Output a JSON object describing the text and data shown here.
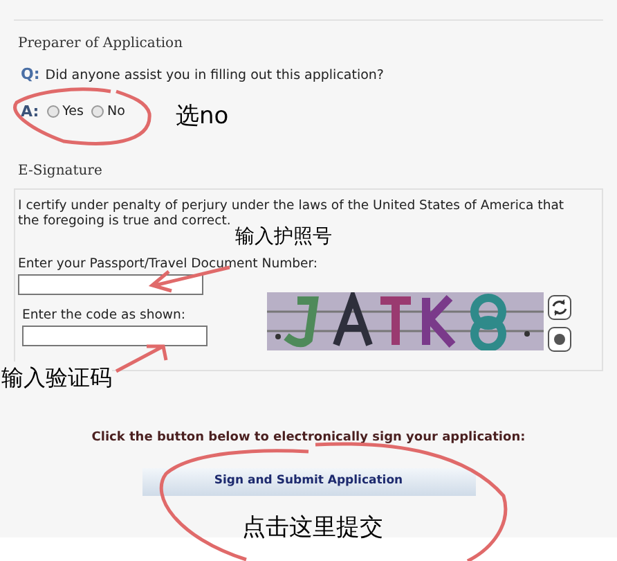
{
  "preparer": {
    "heading": "Preparer of Application",
    "question_marker": "Q:",
    "question": "Did anyone assist you in filling out this application?",
    "answer_marker": "A:",
    "options": [
      {
        "label": "Yes",
        "selected": false
      },
      {
        "label": "No",
        "selected": false
      }
    ]
  },
  "e_signature": {
    "heading": "E-Signature",
    "statement": "I certify under penalty of perjury under the laws of the United States of America that the foregoing is true and correct.",
    "passport_label": "Enter your Passport/Travel Document Number:",
    "code_label": "Enter the code as shown:"
  },
  "submit": {
    "instruction": "Click the button below to electronically sign your application:",
    "button": "Sign and Submit Application"
  },
  "annotations": [
    {
      "text": "选no"
    },
    {
      "text": "输入护照号"
    },
    {
      "text": "输入验证码"
    },
    {
      "text": "点击这里提交"
    }
  ]
}
